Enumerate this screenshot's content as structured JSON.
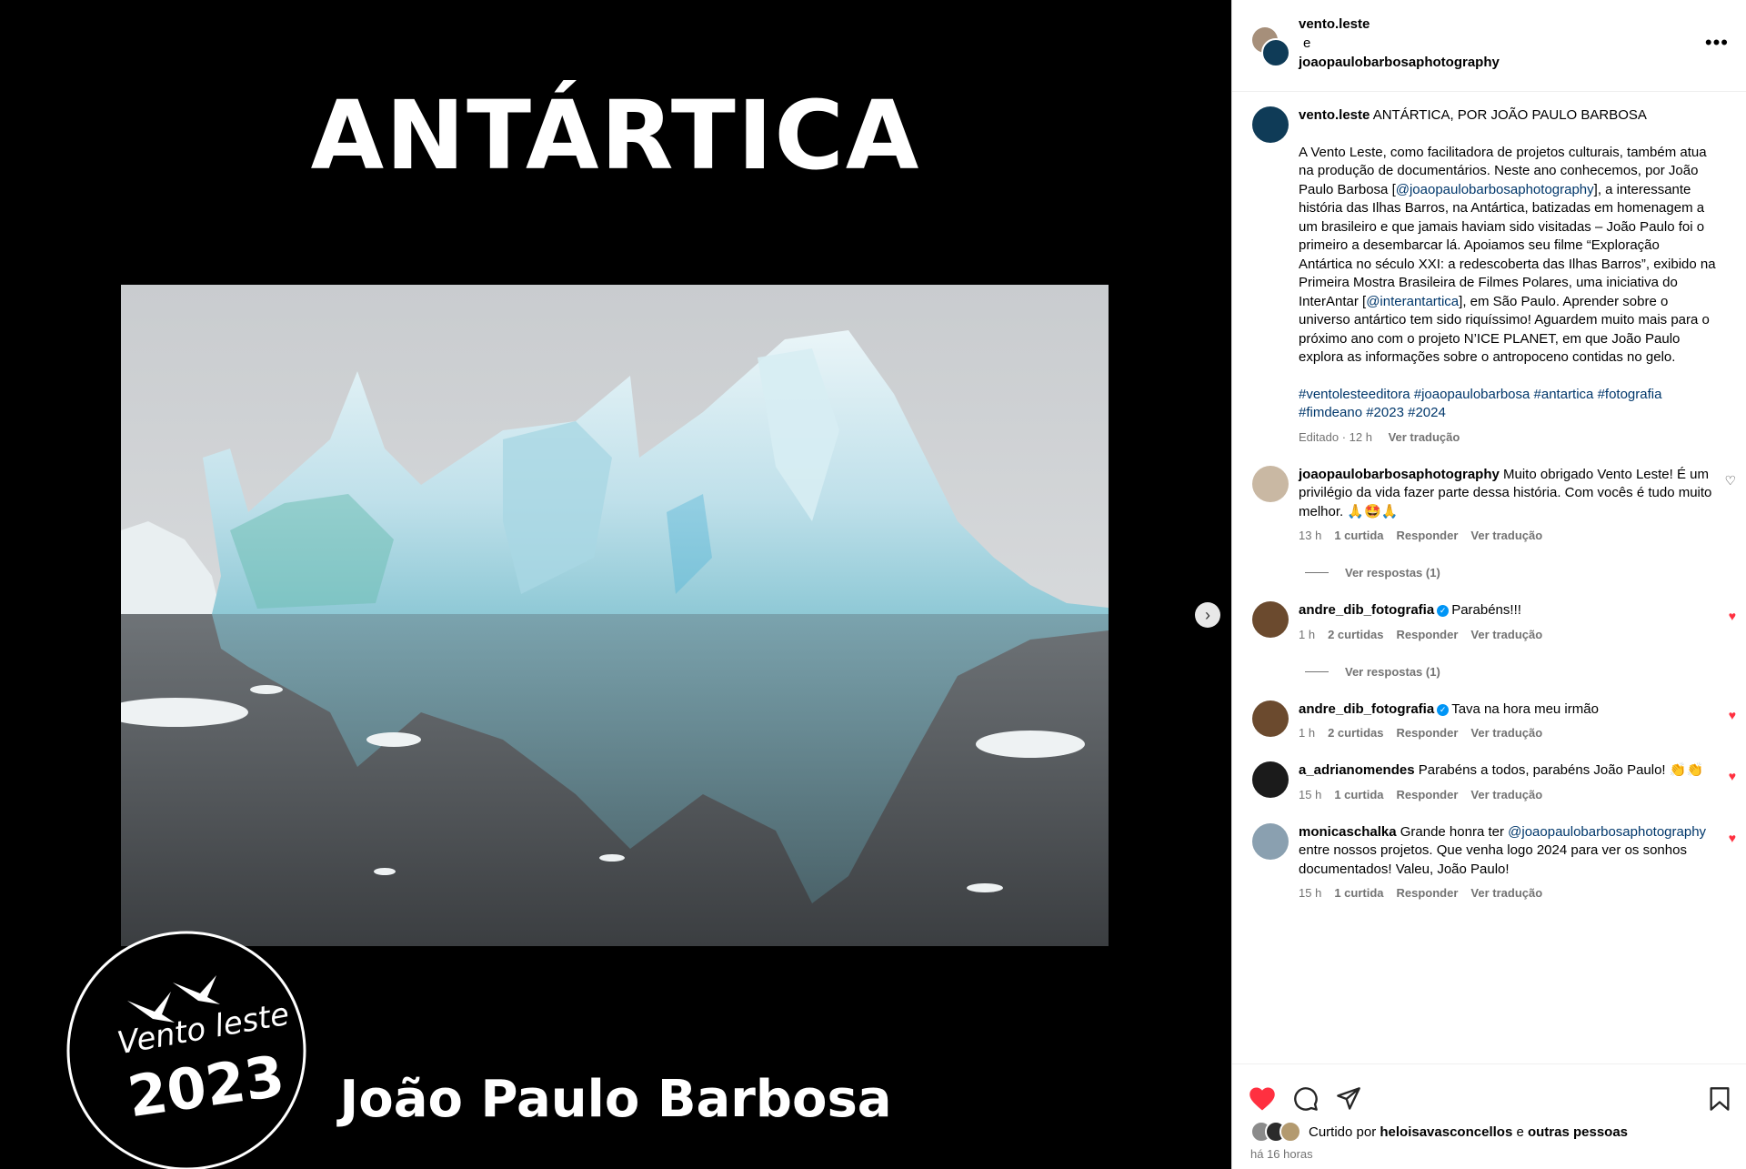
{
  "media": {
    "title": "ANTÁRTICA",
    "author": "João Paulo Barbosa",
    "badge_brand": "Vento leste",
    "badge_year": "2023"
  },
  "header": {
    "user1": "vento.leste",
    "conj": "e",
    "user2": "joaopaulobarbosaphotography",
    "more": "•••"
  },
  "caption": {
    "username": "vento.leste",
    "title": "ANTÁRTICA, POR JOÃO PAULO BARBOSA",
    "p1": "A Vento Leste, como facilitadora de projetos culturais, também atua na produção de documentários. Neste ano conhecemos, por João Paulo Barbosa [",
    "mention1": "@joaopaulobarbosaphotography",
    "p2": "], a interessante história das Ilhas Barros, na Antártica, batizadas em homenagem a um brasileiro e que jamais haviam sido visitadas – João Paulo foi o primeiro a desembarcar lá. Apoiamos seu filme “Exploração Antártica no século XXI: a redescoberta das Ilhas Barros”, exibido na Primeira Mostra Brasileira de Filmes Polares, uma iniciativa do InterAntar [",
    "mention2": "@interantartica",
    "p3": "], em São Paulo. Aprender sobre o universo antártico tem sido riquíssimo! Aguardem muito mais para o próximo ano com o projeto N’ICE PLANET, em que João Paulo explora as informações sobre o antropoceno contidas no gelo.",
    "hashtags": "#ventolesteeditora #joaopaulobarbosa #antartica #fotografia #fimdeano #2023 #2024",
    "edited": "Editado · 12 h",
    "translate": "Ver tradução"
  },
  "comments": [
    {
      "user": "joaopaulobarbosaphotography",
      "verified": false,
      "text": "Muito obrigado Vento Leste! É um privilégio da vida fazer parte dessa história. Com vocês é tudo muito melhor. 🙏🤩🙏",
      "time": "13 h",
      "likes": "1 curtida",
      "reply": "Responder",
      "translate": "Ver tradução",
      "replies": "Ver respostas (1)",
      "liked": false
    },
    {
      "user": "andre_dib_fotografia",
      "verified": true,
      "text": "Parabéns!!!",
      "time": "1 h",
      "likes": "2 curtidas",
      "reply": "Responder",
      "translate": "Ver tradução",
      "replies": "Ver respostas (1)",
      "liked": true
    },
    {
      "user": "andre_dib_fotografia",
      "verified": true,
      "text": "Tava na hora meu irmão",
      "time": "1 h",
      "likes": "2 curtidas",
      "reply": "Responder",
      "translate": "Ver tradução",
      "replies": "",
      "liked": true
    },
    {
      "user": "a_adrianomendes",
      "verified": false,
      "text": "Parabéns a todos, parabéns João Paulo! 👏👏",
      "time": "15 h",
      "likes": "1 curtida",
      "reply": "Responder",
      "translate": "Ver tradução",
      "replies": "",
      "liked": true
    },
    {
      "user": "monicaschalka",
      "verified": false,
      "text_a": "Grande honra ter ",
      "mention": "@joaopaulobarbosaphotography",
      "text_b": " entre nossos projetos. Que venha logo 2024 para ver os sonhos documentados! Valeu, João Paulo!",
      "time": "15 h",
      "likes": "1 curtida",
      "reply": "Responder",
      "translate": "Ver tradução",
      "replies": "",
      "liked": true
    }
  ],
  "footer": {
    "liked_prefix": "Curtido por",
    "liked_user": "heloisavasconcellos",
    "liked_and": "e",
    "liked_others": "outras pessoas",
    "ago": "há 16 horas"
  },
  "colors": {
    "like_red": "#ff3040",
    "link": "#00376b",
    "muted": "#737373"
  }
}
